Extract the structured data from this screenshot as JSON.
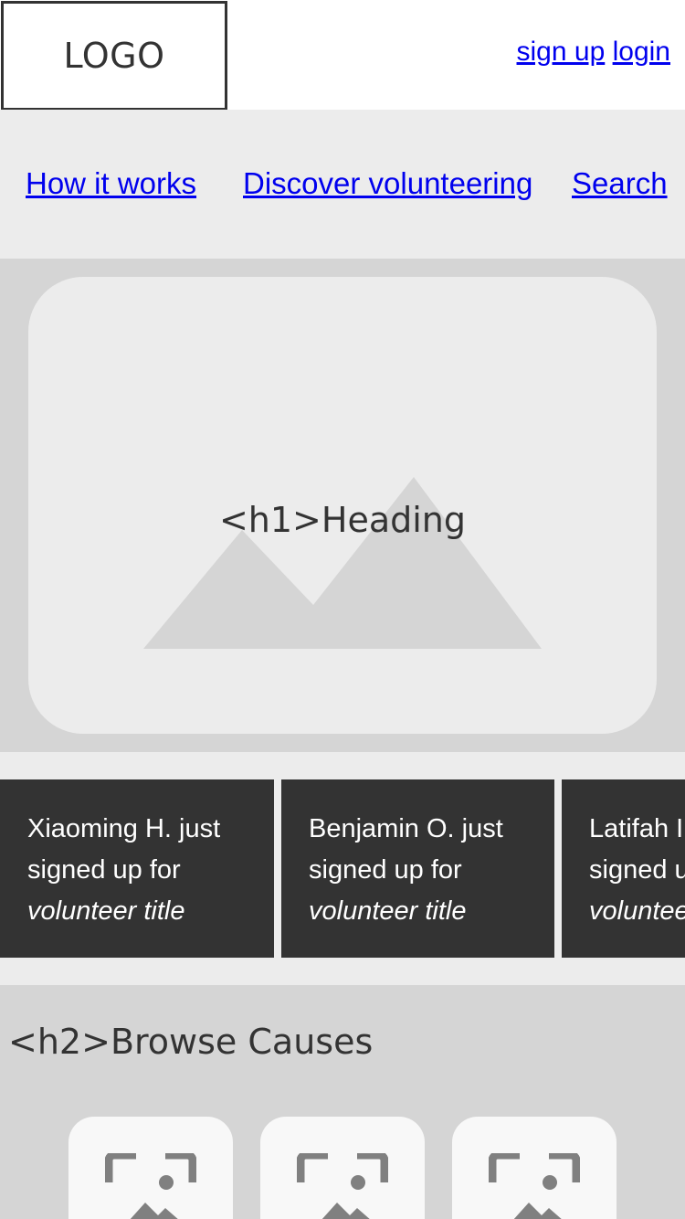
{
  "header": {
    "logo": "LOGO",
    "sign_up": "sign up",
    "login": "login"
  },
  "nav": {
    "items": [
      {
        "label": "How it works"
      },
      {
        "label": "Discover volunteering"
      },
      {
        "label": "Search"
      }
    ]
  },
  "hero": {
    "heading": "<h1>Heading",
    "image_icon": "mountain-placeholder-icon"
  },
  "activity": {
    "items": [
      {
        "line1": "Xiaoming H. just",
        "line2": "signed up for",
        "title": "volunteer title"
      },
      {
        "line1": "Benjamin O. just",
        "line2": "signed up for",
        "title": "volunteer title"
      },
      {
        "line1": "Latifah I. just",
        "line2": "signed up for",
        "title": "volunteer title"
      }
    ]
  },
  "causes": {
    "heading": "<h2>Browse Causes",
    "tile_icon": "image-placeholder-icon"
  },
  "colors": {
    "dark": "#333333",
    "light_band": "#ececec",
    "mid_band": "#d5d5d5",
    "link": "#0000ee"
  }
}
